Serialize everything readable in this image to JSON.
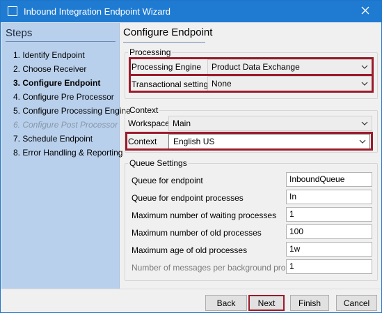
{
  "window": {
    "title": "Inbound Integration Endpoint Wizard"
  },
  "steps": {
    "header": "Steps",
    "items": [
      {
        "label": "1. Identify Endpoint",
        "state": "normal"
      },
      {
        "label": "2. Choose Receiver",
        "state": "normal"
      },
      {
        "label": "3. Configure Endpoint",
        "state": "current"
      },
      {
        "label": "4. Configure Pre Processor",
        "state": "normal"
      },
      {
        "label": "5. Configure Processing Engine",
        "state": "normal"
      },
      {
        "label": "6. Configure Post Processor",
        "state": "disabled"
      },
      {
        "label": "7. Schedule Endpoint",
        "state": "normal"
      },
      {
        "label": "8. Error Handling & Reporting",
        "state": "normal"
      }
    ]
  },
  "main": {
    "title": "Configure Endpoint",
    "processing": {
      "legend": "Processing",
      "engine_label": "Processing Engine",
      "engine_value": "Product Data Exchange",
      "transactional_label": "Transactional settings",
      "transactional_value": "None"
    },
    "context": {
      "legend": "Context",
      "workspace_label": "Workspace",
      "workspace_value": "Main",
      "context_label": "Context",
      "context_value": "English US"
    },
    "queue": {
      "legend": "Queue Settings",
      "rows": [
        {
          "label": "Queue for endpoint",
          "value": "InboundQueue",
          "disabled": false
        },
        {
          "label": "Queue for endpoint processes",
          "value": "In",
          "disabled": false
        },
        {
          "label": "Maximum number of waiting processes",
          "value": "1",
          "disabled": false
        },
        {
          "label": "Maximum number of old processes",
          "value": "100",
          "disabled": false
        },
        {
          "label": "Maximum age of old processes",
          "value": "1w",
          "disabled": false
        },
        {
          "label": "Number of messages per background process",
          "value": "1",
          "disabled": true
        }
      ]
    }
  },
  "buttons": {
    "back": "Back",
    "next": "Next",
    "finish": "Finish",
    "cancel": "Cancel"
  },
  "colors": {
    "titlebar": "#1f7bd1",
    "steps_panel": "#b8d0ec",
    "highlight": "#9b1b2a"
  }
}
